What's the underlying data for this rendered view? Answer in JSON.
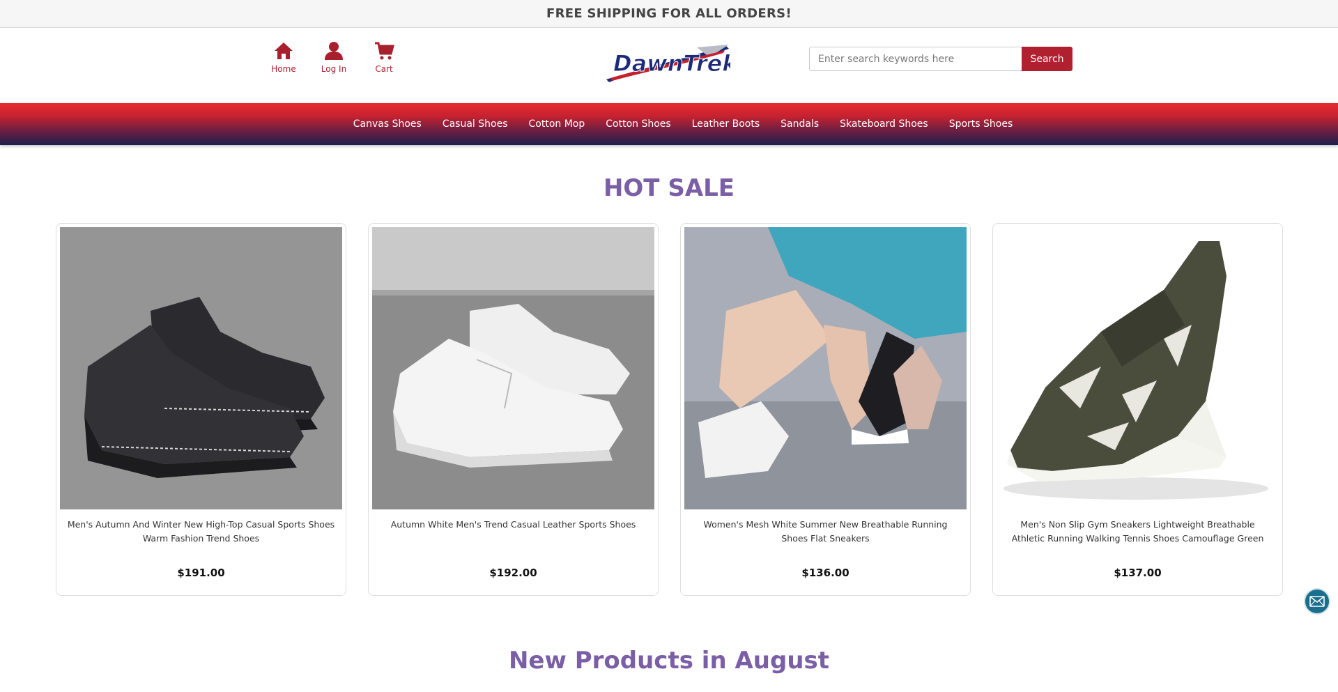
{
  "announcement": "FREE SHIPPING FOR ALL ORDERS!",
  "quick_links": [
    {
      "label": "Home",
      "icon": "home-icon"
    },
    {
      "label": "Log In",
      "icon": "user-icon"
    },
    {
      "label": "Cart",
      "icon": "cart-icon"
    }
  ],
  "logo": {
    "text": "DawnTrek"
  },
  "search": {
    "placeholder": "Enter search keywords here",
    "value": "",
    "button_label": "Search"
  },
  "nav": [
    "Canvas Shoes",
    "Casual Shoes",
    "Cotton Mop",
    "Cotton Shoes",
    "Leather Boots",
    "Sandals",
    "Skateboard Shoes",
    "Sports Shoes"
  ],
  "hot_sale": {
    "title": "HOT SALE",
    "products": [
      {
        "name": "Men's Autumn And Winter New High-Top Casual Sports Shoes Warm Fashion Trend Shoes",
        "price": "$191.00"
      },
      {
        "name": "Autumn White Men's Trend Casual Leather Sports Shoes",
        "price": "$192.00"
      },
      {
        "name": "Women's Mesh White Summer New Breathable Running Shoes Flat Sneakers",
        "price": "$136.00"
      },
      {
        "name": "Men's Non Slip Gym Sneakers Lightweight Breathable Athletic Running Walking Tennis Shoes Camouflage Green",
        "price": "$137.00"
      }
    ]
  },
  "new_products": {
    "title": "New Products in August"
  },
  "colors": {
    "brand_red": "#b1202e",
    "heading_purple": "#7b5fa6",
    "mail_button": "#1b6f8c"
  }
}
